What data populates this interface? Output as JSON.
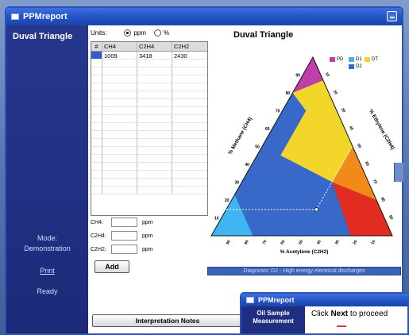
{
  "window": {
    "title": "PPMreport"
  },
  "sidebar": {
    "title": "Duval Triangle",
    "mode_label": "Mode:",
    "mode_value": "Demonstration",
    "print_link": "Print",
    "status": "Ready"
  },
  "units": {
    "label": "Units:",
    "options": [
      "ppm",
      "%"
    ],
    "selected": "ppm"
  },
  "table": {
    "columns": [
      "#",
      "CH4",
      "C2H4",
      "C2H2"
    ],
    "rows": [
      {
        "id": "",
        "ch4": "1009",
        "c2h4": "3418",
        "c2h2": "2430"
      }
    ],
    "empty_rows": 17
  },
  "inputs": [
    {
      "label": "CH4:",
      "value": "",
      "unit": "ppm"
    },
    {
      "label": "C2H4:",
      "value": "",
      "unit": "ppm"
    },
    {
      "label": "C2H2:",
      "value": "",
      "unit": "ppm"
    }
  ],
  "buttons": {
    "add": "Add",
    "interpretation_notes": "Interpretation Notes"
  },
  "chart": {
    "title": "Duval Triangle",
    "legend": [
      {
        "label": "PD",
        "color": "#c13ea8"
      },
      {
        "label": "D1",
        "color": "#3fb6f2"
      },
      {
        "label": "DT",
        "color": "#f2d72a"
      },
      {
        "label": "D2",
        "color": "#3868c8"
      }
    ],
    "left_axis_label": "% Methane (CH4)",
    "right_axis_label": "% Ethylene (C2H4)",
    "bottom_axis_label": "% Acetylene (C2H2)",
    "tick_values": [
      "10",
      "20",
      "30",
      "40",
      "50",
      "60",
      "70",
      "80",
      "90"
    ],
    "point": {
      "ch4_pct": 14.7,
      "c2h4_pct": 49.8,
      "c2h2_pct": 35.5
    },
    "diagnosis_text": "Diagnosis: D2 - High energy electrical discharges"
  },
  "second_window": {
    "title": "PPMreport",
    "sidebar_title_line1": "Oil Sample",
    "sidebar_title_line2": "Measurement",
    "message_prefix": "Click ",
    "message_bold": "Next",
    "message_suffix": " to proceed"
  },
  "colors": {
    "titlebar": "#2253c6",
    "sidebar": "#1f2e80",
    "d1": "#3fb6f2",
    "d2": "#3868c8",
    "dt": "#f2d72a",
    "t3": "#e22c22",
    "t2": "#f28a1a",
    "pd": "#c13ea8"
  }
}
